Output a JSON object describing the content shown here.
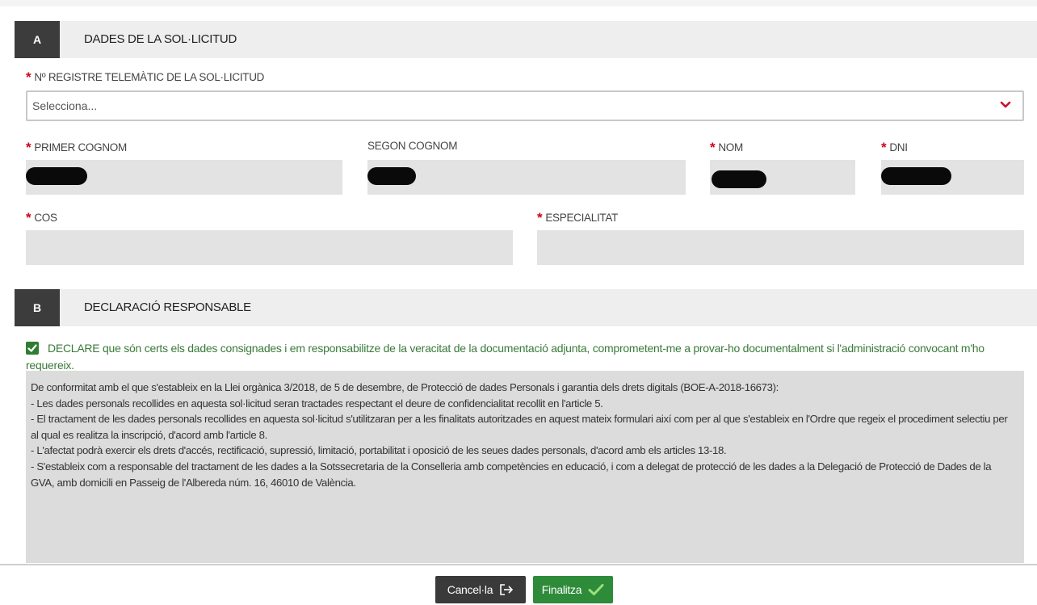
{
  "section_a": {
    "letter": "A",
    "title": "DADES DE LA SOL·LICITUD"
  },
  "registry": {
    "label": "Nº REGISTRE TELEMÀTIC DE LA SOL·LICITUD",
    "placeholder": "Selecciona..."
  },
  "fields": {
    "primer_cognom": "PRIMER COGNOM",
    "segon_cognom": "SEGON COGNOM",
    "nom": "NOM",
    "dni": "DNI",
    "cos": "COS",
    "especialitat": "ESPECIALITAT",
    "required_marker": "*"
  },
  "section_b": {
    "letter": "B",
    "title": "DECLARACIÓ RESPONSABLE"
  },
  "declaration": {
    "checked": true,
    "text": "DECLARE que són certs els dades consignades i em responsabilitze de la veracitat de la documentació adjunta, comprometent-me a provar-ho documentalment si l'administració convocant m'ho requereix."
  },
  "legal": {
    "lines": [
      "De conformitat amb el que s'estableix en la Llei orgànica 3/2018, de 5 de desembre, de Protecció de dades Personals i garantia dels drets digitals (BOE-A-2018-16673):",
      "- Les dades personals recollides en aquesta sol·licitud seran tractades respectant el deure de confidencialitat recollit en l'article 5.",
      "- El tractament de les dades personals recollides en aquesta sol·licitud s'utilitzaran per a les finalitats autoritzades en aquest mateix formulari així com per al que s'estableix en l'Ordre que regeix el procediment selectiu per al qual es realitza la inscripció, d'acord amb l'article 8.",
      "- L'afectat podrà exercir els drets d'accés, rectificació, supressió, limitació, portabilitat i oposició de les seues dades personals, d'acord amb els articles 13-18.",
      "- S'estableix com a responsable del tractament de les dades a la Sotssecretaria de la Conselleria amb competències en educació, i com a delegat de protecció de les dades a la Delegació de Protecció de Dades de la GVA, amb domicili en Passeig de l'Albereda núm. 16, 46010 de València."
    ]
  },
  "buttons": {
    "cancel_label": "Cancel·la",
    "finish_label": "Finalitza"
  },
  "colors": {
    "required": "#d0021b",
    "accent_green": "#2e8b3a",
    "dark": "#3a3a3a"
  },
  "icons": {
    "select": "chevron-down-icon",
    "cancel": "exit-icon",
    "finish": "checkmark-icon",
    "checkbox": "checkbox-checked-icon"
  }
}
